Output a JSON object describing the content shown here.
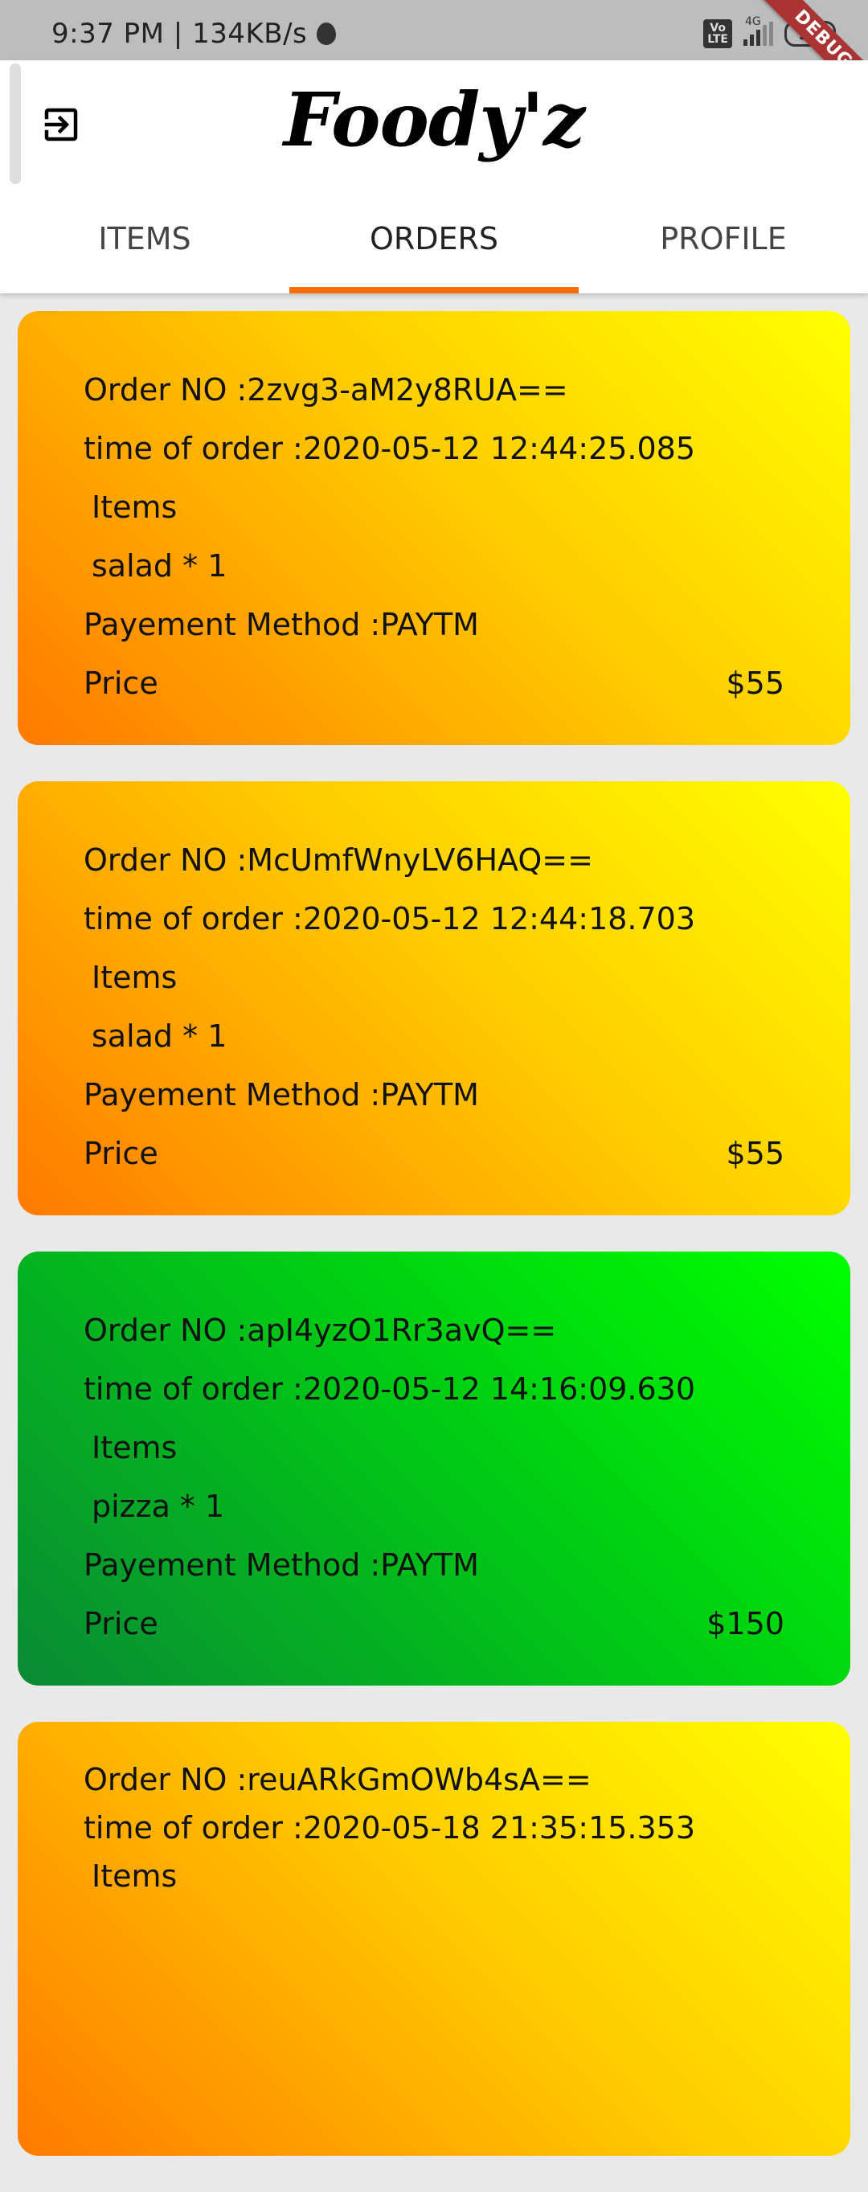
{
  "status_bar": {
    "time_speed": "9:37 PM | 134KB/s",
    "volte": "Vo LTE",
    "network": "4G",
    "battery": "36",
    "debug_banner": "DEBUG"
  },
  "app": {
    "title": "Foody'z",
    "logout_icon": "logout-icon"
  },
  "tabs": [
    {
      "label": "ITEMS",
      "active": false
    },
    {
      "label": "ORDERS",
      "active": true
    },
    {
      "label": "PROFILE",
      "active": false
    }
  ],
  "colors": {
    "accent": "#ff6d00",
    "card_orange_start": "#ff7a00",
    "card_orange_end": "#ffff00",
    "card_green_start": "#0a8a35",
    "card_green_end": "#00ff00"
  },
  "orders": [
    {
      "order_no": "Order NO :2zvg3-aM2y8RUA==",
      "time": "time of order :2020-05-12 12:44:25.085",
      "items_label": "Items",
      "items": "salad * 1",
      "payment": "Payement Method :PAYTM",
      "price_label": "Price",
      "price": "$55",
      "theme": "orange"
    },
    {
      "order_no": "Order NO :McUmfWnyLV6HAQ==",
      "time": "time of order :2020-05-12 12:44:18.703",
      "items_label": "Items",
      "items": "salad * 1",
      "payment": "Payement Method :PAYTM",
      "price_label": "Price",
      "price": "$55",
      "theme": "orange"
    },
    {
      "order_no": "Order NO :apI4yzO1Rr3avQ==",
      "time": "time of order :2020-05-12 14:16:09.630",
      "items_label": "Items",
      "items": "pizza * 1",
      "payment": "Payement Method :PAYTM",
      "price_label": "Price",
      "price": "$150",
      "theme": "green"
    },
    {
      "order_no": "Order NO :reuARkGmOWb4sA==",
      "time": "time of order :2020-05-18 21:35:15.353",
      "items_label": "Items",
      "theme": "orange"
    }
  ]
}
